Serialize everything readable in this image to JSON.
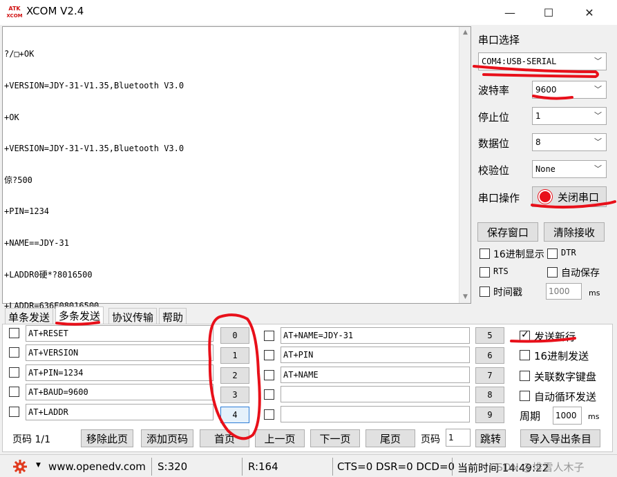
{
  "window": {
    "title": "XCOM V2.4",
    "logo_text": "ATK XCOM",
    "minimize_glyph": "—",
    "maximize_glyph": "☐",
    "close_glyph": "✕"
  },
  "receive": {
    "lines": [
      "?/□+OK",
      "+VERSION=JDY-31-V1.35,Bluetooth V3.0",
      "+OK",
      "+VERSION=JDY-31-V1.35,Bluetooth V3.0",
      "倞?500",
      "+PIN=1234",
      "+NAME==JDY-31",
      "+LADDR0硬*?8016500",
      "+LADDR=636E08016500"
    ]
  },
  "serial": {
    "port_select_label": "串口选择",
    "port_value": "COM4:USB-SERIAL",
    "baud_label": "波特率",
    "baud_value": "9600",
    "stop_label": "停止位",
    "stop_value": "1",
    "data_label": "数据位",
    "data_value": "8",
    "parity_label": "校验位",
    "parity_value": "None",
    "op_label": "串口操作",
    "close_port_label": "关闭串口",
    "save_window_label": "保存窗口",
    "clear_recv_label": "清除接收",
    "hex_display_label": "16进制显示",
    "dtr_label": "DTR",
    "rts_label": "RTS",
    "autosave_label": "自动保存",
    "timestamp_label": "时间戳",
    "timestamp_value": "1000",
    "ms_label": "ms"
  },
  "tabs": [
    "单条发送",
    "多条发送",
    "协议传输",
    "帮助"
  ],
  "multi_send": {
    "left": [
      {
        "cmd": "AT+RESET",
        "num": "0"
      },
      {
        "cmd": "AT+VERSION",
        "num": "1"
      },
      {
        "cmd": "AT+PIN=1234",
        "num": "2"
      },
      {
        "cmd": "AT+BAUD=9600",
        "num": "3"
      },
      {
        "cmd": "AT+LADDR",
        "num": "4"
      }
    ],
    "right": [
      {
        "cmd": "AT+NAME=JDY-31",
        "num": "5"
      },
      {
        "cmd": "AT+PIN",
        "num": "6"
      },
      {
        "cmd": "AT+NAME",
        "num": "7"
      },
      {
        "cmd": "",
        "num": "8"
      },
      {
        "cmd": "",
        "num": "9"
      }
    ],
    "send_newline_label": "发送新行",
    "hex_send_label": "16进制发送",
    "link_keyboard_label": "关联数字键盘",
    "auto_loop_label": "自动循环发送",
    "period_label": "周期",
    "period_value": "1000",
    "period_unit": "ms",
    "page_label": "页码 1/1",
    "remove_page_label": "移除此页",
    "add_page_label": "添加页码",
    "first_page_label": "首页",
    "prev_page_label": "上一页",
    "next_page_label": "下一页",
    "last_page_label": "尾页",
    "page_input_label": "页码",
    "page_input_value": "1",
    "jump_label": "跳转",
    "import_export_label": "导入导出条目"
  },
  "status": {
    "url": "www.openedv.com",
    "sent": "S:320",
    "recv": "R:164",
    "signals": "CTS=0 DSR=0 DCD=0",
    "time": "当前时间 14:49:22",
    "watermark": "CSDN @堆雪人木子"
  },
  "colors": {
    "annotation_red": "#e8101a",
    "gear_red": "#e03a1e"
  }
}
